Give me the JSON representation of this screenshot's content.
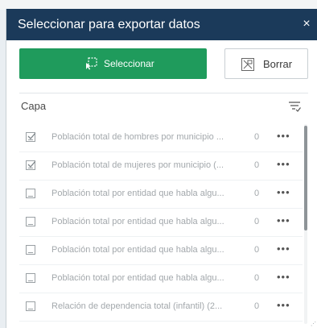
{
  "panel": {
    "title": "Seleccionar para exportar datos",
    "close_label": "×"
  },
  "actions": {
    "select_label": "Seleccionar",
    "clear_label": "Borrar"
  },
  "list": {
    "column_header": "Capa",
    "rows": [
      {
        "name": "Población total de hombres por municipio ...",
        "count": "0",
        "checked": true
      },
      {
        "name": "Población total de mujeres por municipio (...",
        "count": "0",
        "checked": true
      },
      {
        "name": "Población total por entidad que habla algu...",
        "count": "0",
        "checked": false
      },
      {
        "name": "Población total por entidad que habla algu...",
        "count": "0",
        "checked": false
      },
      {
        "name": "Población total por entidad que habla algu...",
        "count": "0",
        "checked": false
      },
      {
        "name": "Población total por entidad que habla algu...",
        "count": "0",
        "checked": false
      },
      {
        "name": "Relación de dependencia total (infantil) (2...",
        "count": "0",
        "checked": false
      }
    ],
    "more_label": "•••"
  },
  "colors": {
    "header_bg": "#1b3a5a",
    "accent_green": "#1f9b5c"
  },
  "icons": {
    "select": "select-rectangle-icon",
    "clear": "clear-selection-icon",
    "filter": "filter-list-icon",
    "checkbox": "checkbox-icon"
  }
}
